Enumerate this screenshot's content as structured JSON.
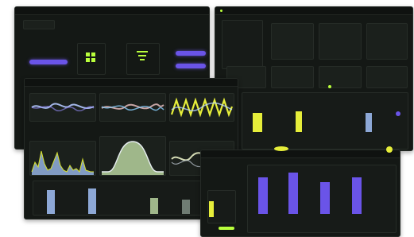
{
  "windows": {
    "top_left": {
      "title": ""
    },
    "top_right": {
      "title": ""
    },
    "middle_left": {
      "title": ""
    },
    "right_bottom": {
      "title": ""
    }
  },
  "colors": {
    "accent": "#d7e22c",
    "purple": "#6a54e8",
    "blue": "#8da8d6",
    "sage": "#9fb78a",
    "dark": "#141815"
  },
  "icons": [
    "grid-icon",
    "filter-icon",
    "toggle-icon",
    "status-dot-icon"
  ]
}
